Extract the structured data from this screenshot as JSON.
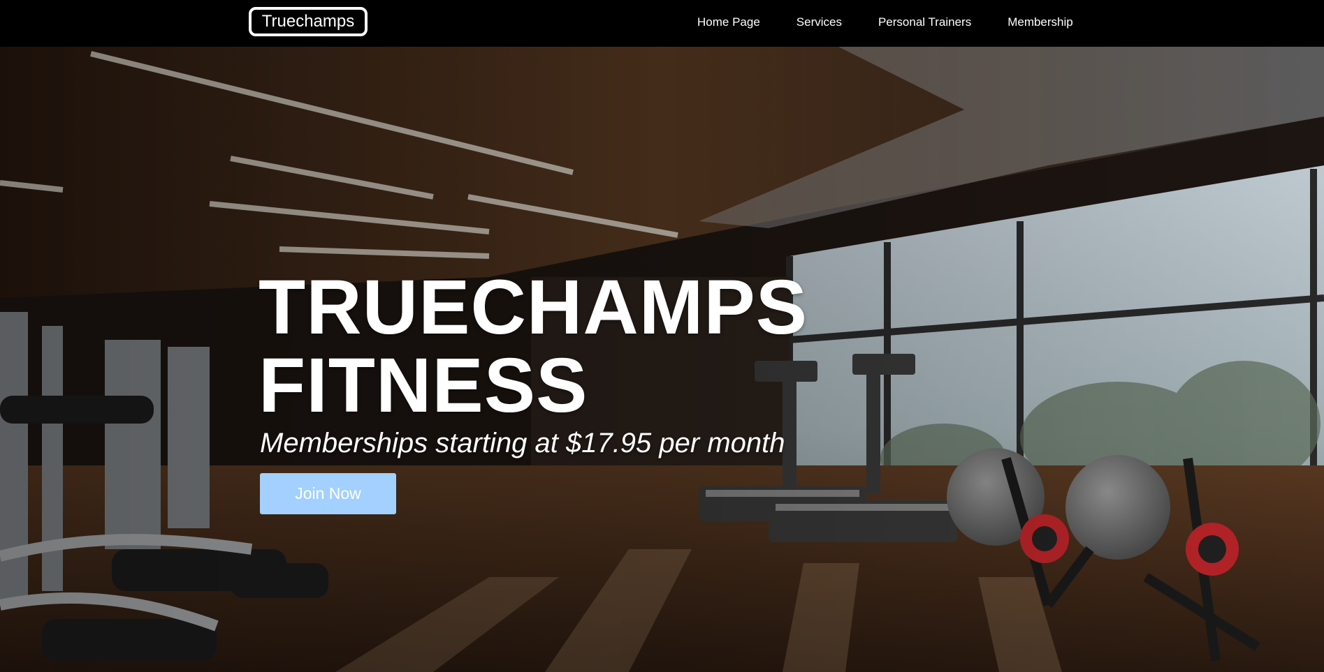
{
  "brand": {
    "logo_text": "Truechamps"
  },
  "nav": {
    "items": [
      {
        "label": "Home Page"
      },
      {
        "label": "Services"
      },
      {
        "label": "Personal Trainers"
      },
      {
        "label": "Membership"
      }
    ]
  },
  "hero": {
    "title_line1": "TRUECHAMPS",
    "title_line2": "FITNESS",
    "subtitle": "Memberships starting at $17.95 per month",
    "cta_label": "Join Now",
    "background_image": "gym-interior-photo"
  },
  "colors": {
    "navbar_bg": "#000000",
    "text": "#ffffff",
    "cta_bg": "#a3d0ff"
  }
}
